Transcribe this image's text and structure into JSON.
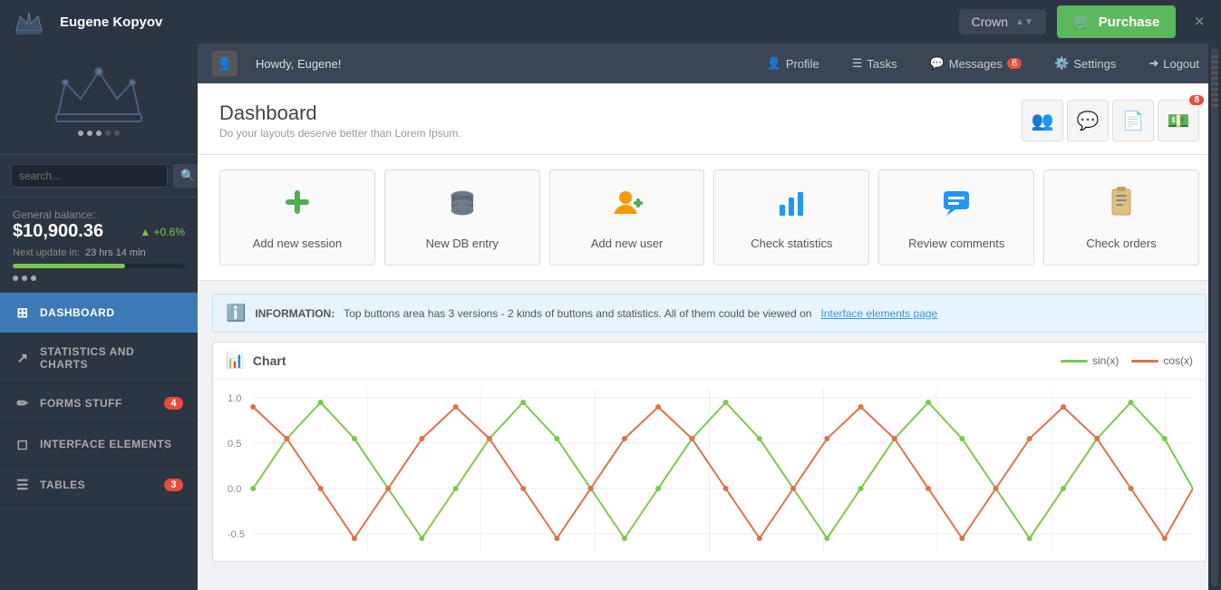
{
  "header": {
    "username": "Eugene Kopyov",
    "crown_label": "Crown",
    "purchase_label": "Purchase",
    "close_label": "×"
  },
  "topbar": {
    "greeting": "Howdy, Eugene!",
    "profile": "Profile",
    "tasks": "Tasks",
    "messages": "Messages",
    "messages_badge": "8",
    "settings": "Settings",
    "logout": "Logout"
  },
  "dashboard": {
    "title": "Dashboard",
    "subtitle": "Do your layouts deserve better than Lorem Ipsum.",
    "icon_badge": "8"
  },
  "sidebar": {
    "search_placeholder": "search...",
    "balance_label": "General balance:",
    "balance_amount": "$10,900.36",
    "balance_change": "+0.6%",
    "next_update_label": "Next update in:",
    "next_update_time": "23 hrs  14 min",
    "nav_items": [
      {
        "id": "dashboard",
        "label": "DASHBOARD",
        "icon": "⊞",
        "active": true,
        "badge": ""
      },
      {
        "id": "statistics",
        "label": "STATISTICS AND CHARTS",
        "icon": "📊",
        "active": false,
        "badge": ""
      },
      {
        "id": "forms",
        "label": "FORMS STUFF",
        "icon": "✏️",
        "active": false,
        "badge": "4"
      },
      {
        "id": "interface",
        "label": "INTERFACE ELEMENTS",
        "icon": "👤",
        "active": false,
        "badge": ""
      },
      {
        "id": "tables",
        "label": "TABLES",
        "icon": "⊞",
        "active": false,
        "badge": "3"
      }
    ]
  },
  "action_buttons": [
    {
      "id": "add-session",
      "label": "Add new session",
      "icon": "➕",
      "color": "#4caf50"
    },
    {
      "id": "new-db",
      "label": "New DB entry",
      "icon": "🗄️",
      "color": "#888"
    },
    {
      "id": "add-user",
      "label": "Add new user",
      "icon": "👤",
      "color": "#ff9800"
    },
    {
      "id": "check-stats",
      "label": "Check statistics",
      "icon": "📊",
      "color": "#2196f3"
    },
    {
      "id": "review-comments",
      "label": "Review comments",
      "icon": "💬",
      "color": "#2196f3"
    },
    {
      "id": "check-orders",
      "label": "Check orders",
      "icon": "📋",
      "color": "#ff9800"
    }
  ],
  "info": {
    "label": "INFORMATION:",
    "text": "Top buttons area has 3 versions - 2 kinds of buttons and statistics. All of them could be viewed on",
    "link_text": "Interface elements page"
  },
  "chart": {
    "title": "Chart",
    "legend": [
      {
        "label": "sin(x)",
        "color": "#7dc74e"
      },
      {
        "label": "cos(x)",
        "color": "#e07050"
      }
    ],
    "y_labels": [
      "1.0",
      "0.5",
      "0.0",
      "-0.5"
    ]
  }
}
